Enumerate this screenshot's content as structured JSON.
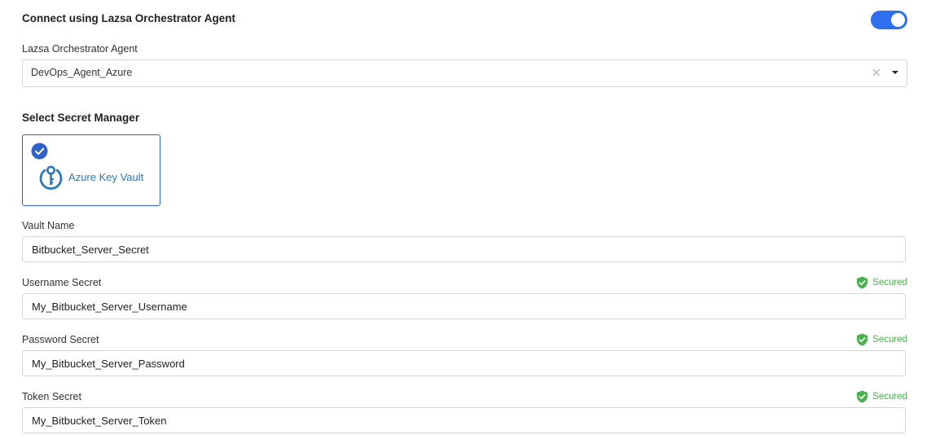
{
  "connect": {
    "title": "Connect using Lazsa Orchestrator Agent",
    "enabled": true,
    "accent_color": "#2f6fed"
  },
  "agent": {
    "label": "Lazsa Orchestrator Agent",
    "value": "DevOps_Agent_Azure"
  },
  "secret_manager": {
    "title": "Select Secret Manager",
    "selected_option": "Azure Key Vault",
    "icon": "key-vault-icon"
  },
  "vault_name": {
    "label": "Vault Name",
    "value": "Bitbucket_Server_Secret"
  },
  "username_secret": {
    "label": "Username Secret",
    "value": "My_Bitbucket_Server_Username",
    "status": "Secured"
  },
  "password_secret": {
    "label": "Password Secret",
    "value": "My_Bitbucket_Server_Password",
    "status": "Secured"
  },
  "token_secret": {
    "label": "Token Secret",
    "value": "My_Bitbucket_Server_Token",
    "status": "Secured"
  },
  "colors": {
    "secured": "#4caf50",
    "card_border": "#2f62c9",
    "vault_text": "#2a7ab8"
  }
}
